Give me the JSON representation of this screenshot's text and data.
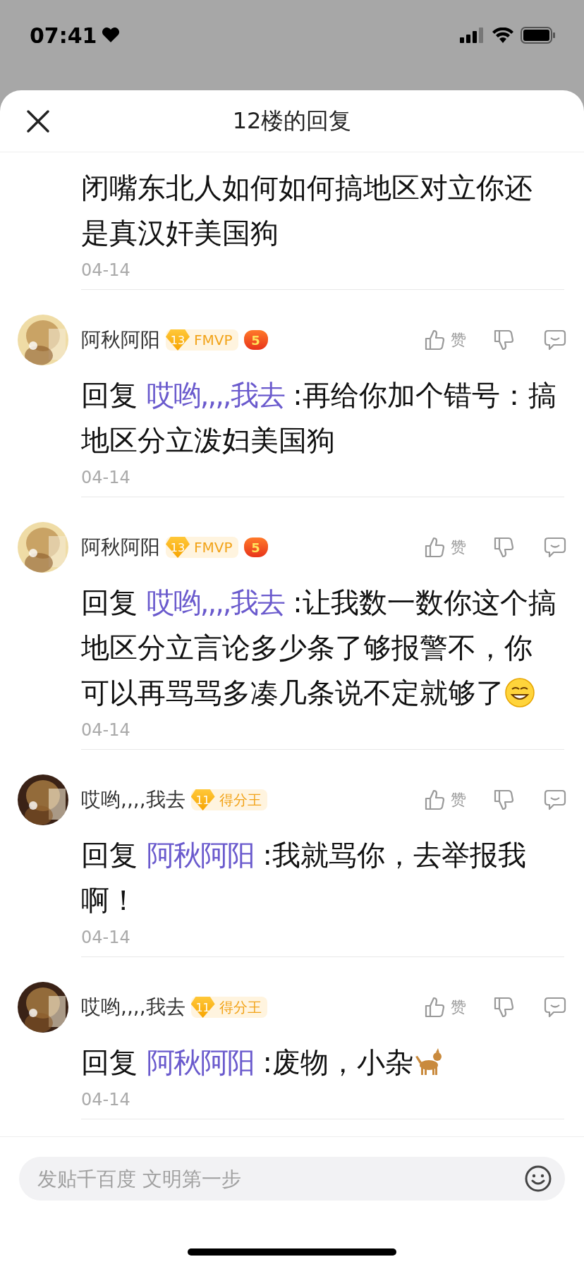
{
  "status_bar": {
    "time": "07:41"
  },
  "sheet": {
    "title": "12楼的回复"
  },
  "top_comment": {
    "text": "闭嘴东北人如何如何搞地区对立你还是真汉奸美国狗",
    "date": "04-14"
  },
  "comments": [
    {
      "user": "阿秋阿阳",
      "level": "13",
      "badge": "FMVP",
      "game_badge": "5",
      "like_label": "赞",
      "reply_label": "回复",
      "reply_to": "哎哟,,,,我去",
      "text": ":再给你加个错号：搞地区分立泼妇美国狗",
      "date": "04-14"
    },
    {
      "user": "阿秋阿阳",
      "level": "13",
      "badge": "FMVP",
      "game_badge": "5",
      "like_label": "赞",
      "reply_label": "回复",
      "reply_to": "哎哟,,,,我去",
      "text": ":让我数一数你这个搞地区分立言论多少条了够报警不，你可以再骂骂多凑几条说不定就够了",
      "emoji": {
        "kind": "grin"
      },
      "date": "04-14"
    },
    {
      "user": "哎哟,,,,我去",
      "level": "11",
      "badge": "得分王",
      "like_label": "赞",
      "reply_label": "回复",
      "reply_to": "阿秋阿阳",
      "text": ":我就骂你，去举报我啊！",
      "date": "04-14"
    },
    {
      "user": "哎哟,,,,我去",
      "level": "11",
      "badge": "得分王",
      "like_label": "赞",
      "reply_label": "回复",
      "reply_to": "阿秋阿阳",
      "text": ":废物，小杂",
      "emoji": {
        "kind": "dog"
      },
      "date": "04-14"
    }
  ],
  "composer": {
    "placeholder": "发贴千百度 文明第一步"
  }
}
